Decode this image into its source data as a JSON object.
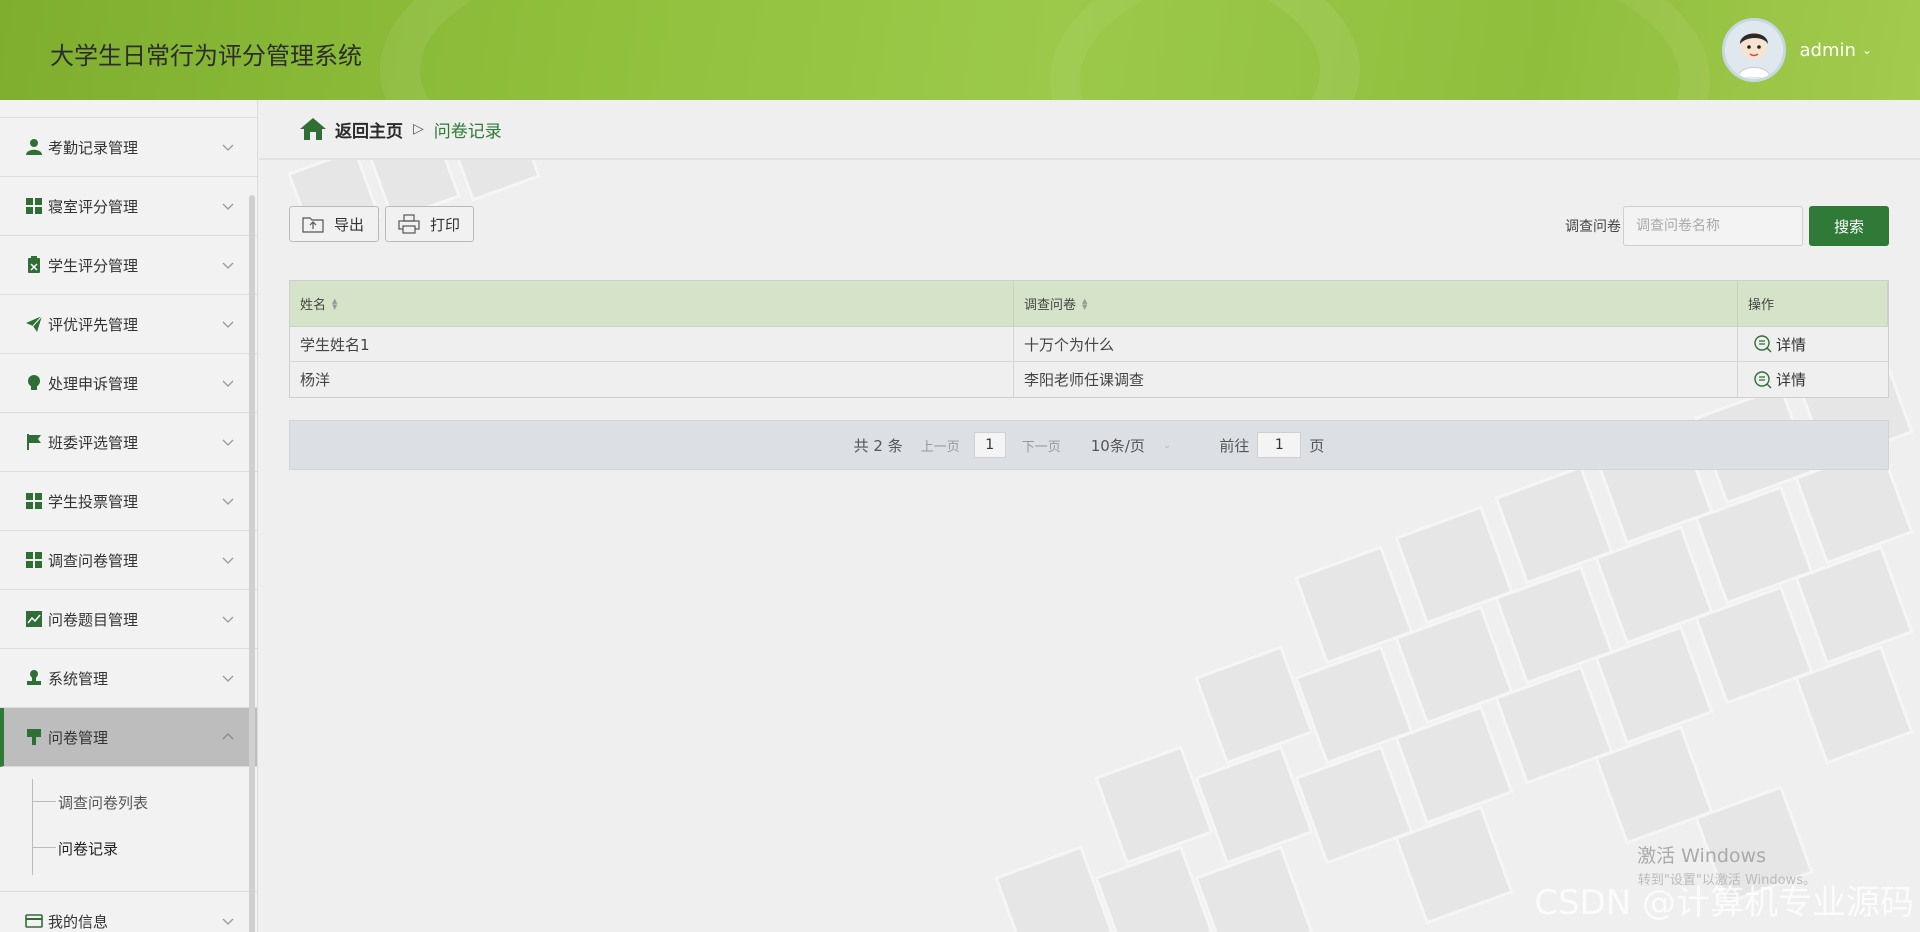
{
  "header": {
    "title": "大学生日常行为评分管理系统",
    "user_name": "admin",
    "accent_color": "#8fc03c"
  },
  "sidebar": {
    "items": [
      {
        "label": "考勤记录管理",
        "icon": "user-icon"
      },
      {
        "label": "寝室评分管理",
        "icon": "grid-icon"
      },
      {
        "label": "学生评分管理",
        "icon": "clipboard-x-icon"
      },
      {
        "label": "评优评先管理",
        "icon": "paper-plane-icon"
      },
      {
        "label": "处理申诉管理",
        "icon": "bulb-icon"
      },
      {
        "label": "班委评选管理",
        "icon": "flag-icon"
      },
      {
        "label": "学生投票管理",
        "icon": "grid-icon"
      },
      {
        "label": "调查问卷管理",
        "icon": "grid-icon"
      },
      {
        "label": "问卷题目管理",
        "icon": "chart-icon"
      },
      {
        "label": "系统管理",
        "icon": "stamp-icon"
      },
      {
        "label": "问卷管理",
        "icon": "brush-icon",
        "active": true
      },
      {
        "label": "我的信息",
        "icon": "card-icon"
      }
    ],
    "submenu": [
      {
        "label": "调查问卷列表"
      },
      {
        "label": "问卷记录",
        "current": true
      }
    ]
  },
  "breadcrumb": {
    "home": "返回主页",
    "separator": "▷",
    "current": "问卷记录"
  },
  "toolbar": {
    "export_label": "导出",
    "print_label": "打印",
    "search_label": "调查问卷",
    "search_placeholder": "调查问卷名称",
    "search_button": "搜索"
  },
  "table": {
    "headers": [
      "姓名",
      "调查问卷",
      "操作"
    ],
    "rows": [
      {
        "name": "学生姓名1",
        "survey": "十万个为什么",
        "action": "详情"
      },
      {
        "name": "杨洋",
        "survey": "李阳老师任课调查",
        "action": "详情"
      }
    ]
  },
  "pagination": {
    "total": "共 2 条",
    "prev": "上一页",
    "page": "1",
    "next": "下一页",
    "page_size": "10条/页",
    "goto_label": "前往",
    "goto_value": "1",
    "goto_suffix": "页"
  },
  "watermark": {
    "activate": "激活 Windows",
    "activate_sub": "转到\"设置\"以激活 Windows。",
    "csdn": "CSDN @计算机专业源码"
  },
  "colors": {
    "primary_green": "#2f7a37",
    "table_header": "#d5e4c8"
  }
}
